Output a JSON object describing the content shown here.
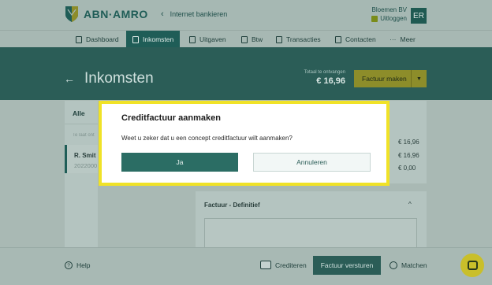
{
  "header": {
    "logo_text": "ABN·AMRO",
    "back_link": "Internet bankieren",
    "company_name": "Bloemen BV",
    "logout_label": "Uitloggen",
    "avatar_initials": "ER"
  },
  "nav": {
    "items": [
      {
        "label": "Dashboard",
        "icon": "dashboard-icon"
      },
      {
        "label": "Inkomsten",
        "icon": "document-icon",
        "active": true
      },
      {
        "label": "Uitgaven",
        "icon": "wallet-icon"
      },
      {
        "label": "Btw",
        "icon": "percent-icon"
      },
      {
        "label": "Transacties",
        "icon": "list-icon"
      },
      {
        "label": "Contacten",
        "icon": "contact-icon"
      },
      {
        "label": "Meer",
        "icon": "more-icon"
      }
    ]
  },
  "page": {
    "title": "Inkomsten",
    "totaal_label": "Totaal te ontvangen",
    "totaal_value": "€ 16,96",
    "factuur_button": "Factuur maken"
  },
  "list": {
    "filter_label": "Alle",
    "section_label": "Te laat ont",
    "item_name": "R. Smit",
    "item_number": "2022000"
  },
  "amounts": [
    "€ 16,96",
    "€ 16,96",
    "€ 0,00"
  ],
  "definitief": {
    "title": "Factuur - Definitief"
  },
  "footer": {
    "help_label": "Help",
    "crediteren_label": "Crediteren",
    "versturen_label": "Factuur versturen",
    "matchen_label": "Matchen"
  },
  "modal": {
    "title": "Creditfactuur aanmaken",
    "message": "Weet u zeker dat u een concept creditfactuur wilt aanmaken?",
    "confirm_label": "Ja",
    "cancel_label": "Annuleren"
  },
  "colors": {
    "brand_green": "#1f5d57",
    "accent_yellow": "#f0e227",
    "button_green": "#2b6d64"
  }
}
